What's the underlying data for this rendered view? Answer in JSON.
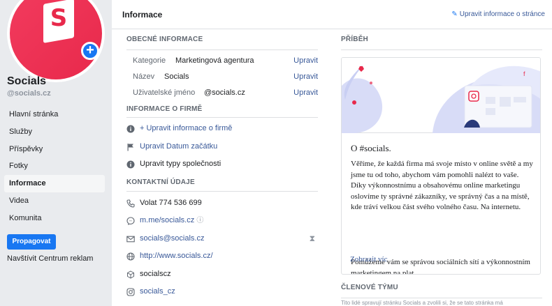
{
  "sidebar": {
    "page_name": "Socials",
    "page_handle": "@socials.cz",
    "logo_letter": "S",
    "nav": [
      {
        "label": "Hlavní stránka",
        "active": false
      },
      {
        "label": "Služby",
        "active": false
      },
      {
        "label": "Příspěvky",
        "active": false
      },
      {
        "label": "Fotky",
        "active": false
      },
      {
        "label": "Informace",
        "active": true
      },
      {
        "label": "Videa",
        "active": false
      },
      {
        "label": "Komunita",
        "active": false
      }
    ],
    "promote_label": "Propagovat",
    "ad_center_label": "Navštívit Centrum reklam"
  },
  "header": {
    "title": "Informace",
    "edit_link": "Upravit informace o stránce"
  },
  "general": {
    "title": "OBECNÉ INFORMACE",
    "rows": [
      {
        "label": "Kategorie",
        "value": "Marketingová agentura",
        "edit": "Upravit"
      },
      {
        "label": "Název",
        "value": "Socials",
        "edit": "Upravit"
      },
      {
        "label": "Uživatelské jméno",
        "value": "@socials.cz",
        "edit": "Upravit"
      }
    ]
  },
  "company": {
    "title": "INFORMACE O FIRMĚ",
    "items": [
      {
        "icon": "info-icon",
        "text": "+ Upravit informace o firmě"
      },
      {
        "icon": "flag-icon",
        "text": "Upravit Datum začátku"
      },
      {
        "icon": "info-icon",
        "text": "Upravit typy společnosti"
      }
    ]
  },
  "contact": {
    "title": "KONTAKTNÍ ÚDAJE",
    "items": [
      {
        "icon": "phone-icon",
        "text": "Volat 774 536 699"
      },
      {
        "icon": "messenger-icon",
        "text": "m.me/socials.cz"
      },
      {
        "icon": "mail-icon",
        "text": "socials@socials.cz"
      },
      {
        "icon": "globe-icon",
        "text": "http://www.socials.cz/"
      },
      {
        "icon": "cube-icon",
        "text": "socialscz"
      },
      {
        "icon": "instagram-icon",
        "text": "socials_cz"
      }
    ]
  },
  "story": {
    "title": "PŘÍBĚH",
    "heading": "O #socials.",
    "paragraph1": "Věříme, že každá firma má svoje místo v online světě a my jsme tu od toho, abychom vám pomohli nalézt to vaše. Díky výkonnostnímu a obsahovému online marketingu oslovíme ty správné zákazníky, ve správný čas a na místě, kde tráví velkou část svého volného času. Na internetu.",
    "paragraph2": "Pomůžeme vám se správou sociálních sítí a výkonnostním marketingem na plat...",
    "more": "Zobrazit víc"
  },
  "team": {
    "title": "ČLENOVÉ TÝMU",
    "desc": "Tito lidé spravují stránku Socials a zvolili si, že se tato stránka má"
  },
  "colors": {
    "accent": "#1877f2",
    "link": "#385898",
    "brand": "#e8294b",
    "sidebar_bg": "#e9ebee"
  }
}
